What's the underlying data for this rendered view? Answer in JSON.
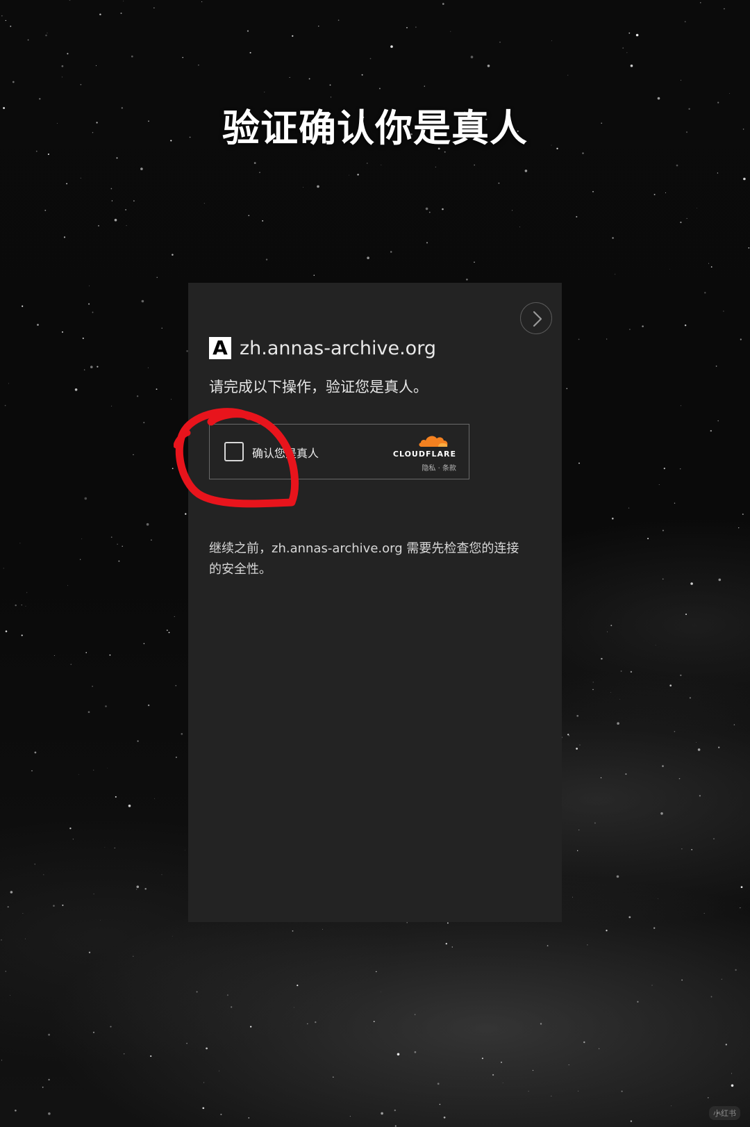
{
  "headline": "验证确认你是真人",
  "dialog": {
    "site_logo": "A",
    "site_name": "zh.annas-archive.org",
    "instruction": "请完成以下操作，验证您是真人。",
    "challenge": {
      "checkbox_label": "确认您是真人",
      "checked": false,
      "brand": "CLOUDFLARE",
      "privacy_link": "隐私",
      "separator": "·",
      "terms_link": "条款"
    },
    "footer_line_1": "继续之前，zh.annas-archive.org 需要先检查您的连接",
    "footer_line_2": "的安全性。"
  },
  "watermark": "小红书",
  "colors": {
    "panel": "#232323",
    "annotation": "#e8141c",
    "cloudflare_orange": "#f48120",
    "text": "#e6e6e6"
  },
  "icons": {
    "nav": "chevron-right-icon",
    "brand": "cloud-icon"
  }
}
